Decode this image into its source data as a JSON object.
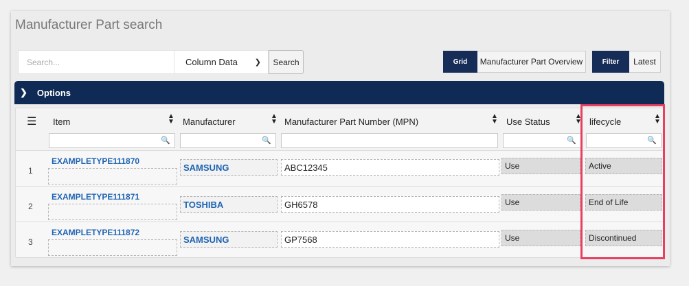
{
  "page": {
    "title": "Manufacturer Part search"
  },
  "search": {
    "placeholder": "Search...",
    "column_select": "Column Data",
    "button": "Search"
  },
  "view_toggle": {
    "grid": "Grid",
    "overview": "Manufacturer Part Overview"
  },
  "filter_toggle": {
    "filter": "Filter",
    "latest": "Latest"
  },
  "options": {
    "label": "Options"
  },
  "grid": {
    "columns": [
      "Item",
      "Manufacturer",
      "Manufacturer Part Number (MPN)",
      "Use Status",
      "lifecycle"
    ],
    "rows": [
      {
        "num": "1",
        "item": "EXAMPLETYPE111870",
        "manufacturer": "SAMSUNG",
        "mpn": "ABC12345",
        "use_status": "Use",
        "lifecycle": "Active"
      },
      {
        "num": "2",
        "item": "EXAMPLETYPE111871",
        "manufacturer": "TOSHIBA",
        "mpn": "GH6578",
        "use_status": "Use",
        "lifecycle": "End of Life"
      },
      {
        "num": "3",
        "item": "EXAMPLETYPE111872",
        "manufacturer": "SAMSUNG",
        "mpn": "GP7568",
        "use_status": "Use",
        "lifecycle": "Discontinued"
      }
    ]
  },
  "colors": {
    "navy": "#0f2a55",
    "link": "#1f64b3",
    "highlight": "#e83f5f"
  }
}
